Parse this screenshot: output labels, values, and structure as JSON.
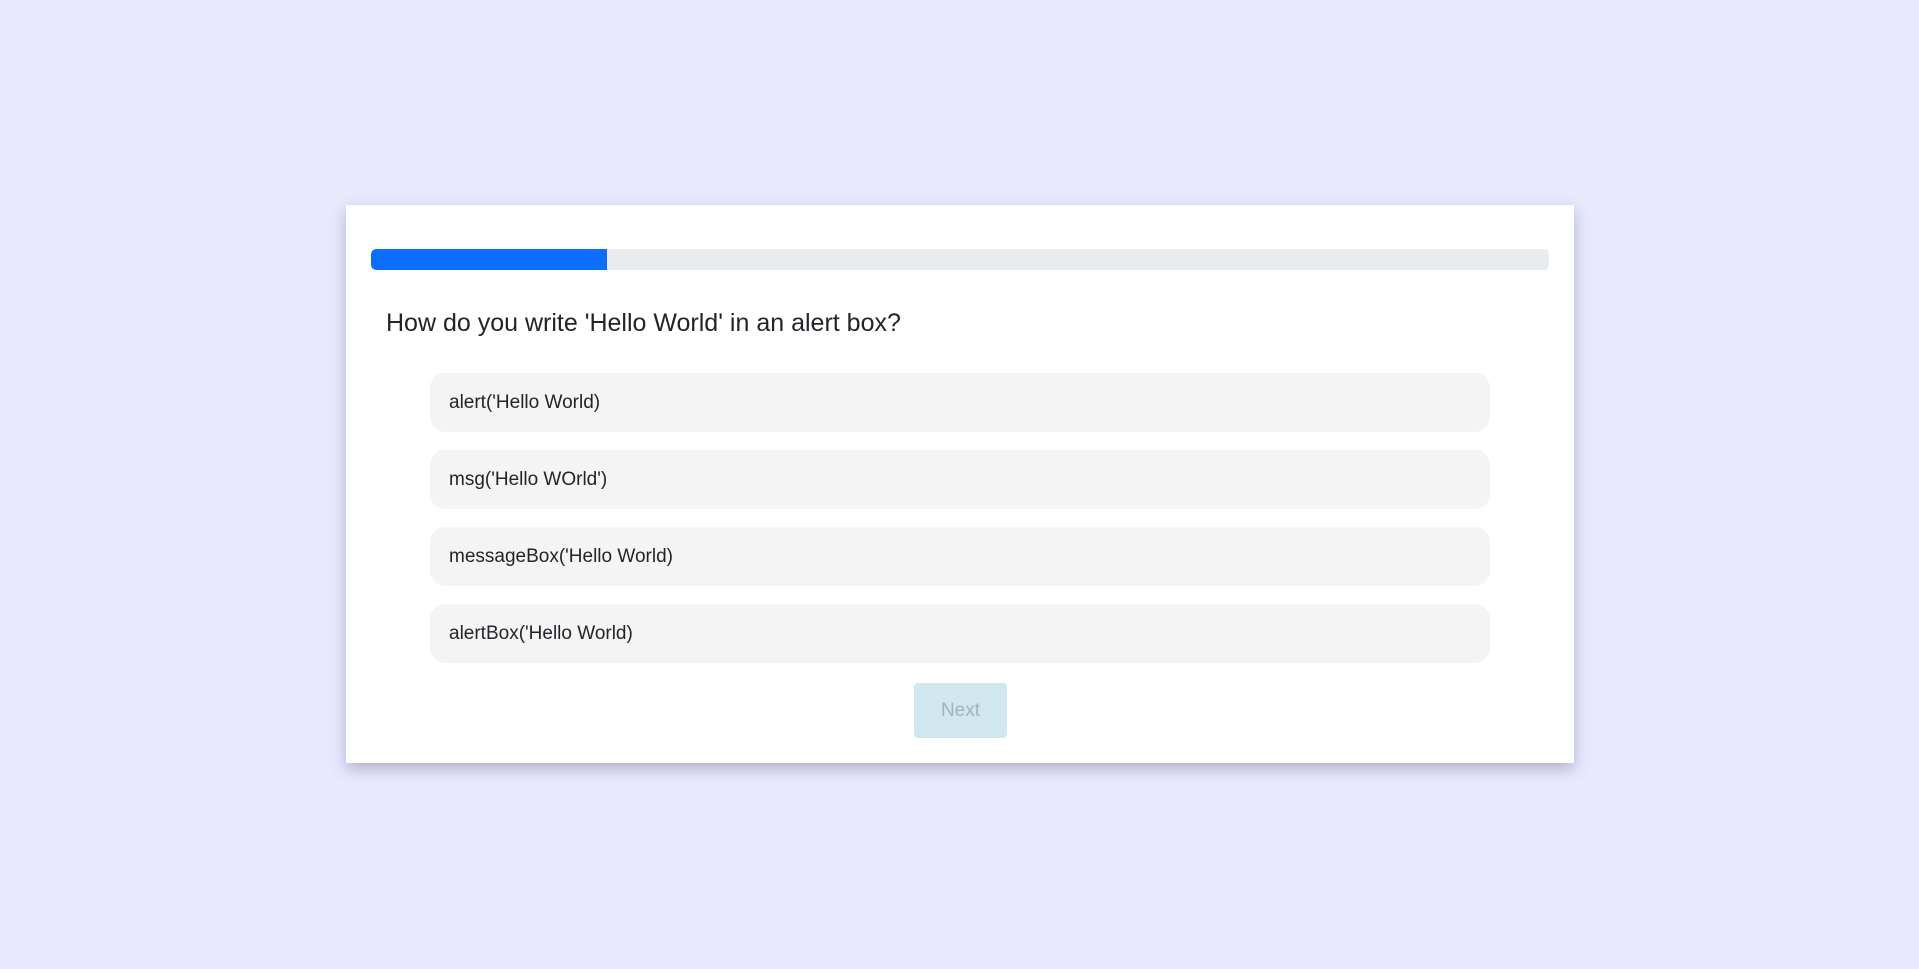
{
  "quiz": {
    "progress_fraction": 0.2,
    "question": "How do you write 'Hello World' in an alert box?",
    "options": [
      {
        "label": "alert('Hello World)"
      },
      {
        "label": "msg('Hello WOrld')"
      },
      {
        "label": "messageBox('Hello World)"
      },
      {
        "label": "alertBox('Hello World)"
      }
    ],
    "next_label": "Next",
    "next_disabled": true
  },
  "colors": {
    "page_background": "#e8e8fe",
    "progress_fill": "#0d6efd",
    "progress_track": "#e9ecef",
    "option_background": "#f4f4f4",
    "next_button_disabled": "#d1e7f0"
  }
}
